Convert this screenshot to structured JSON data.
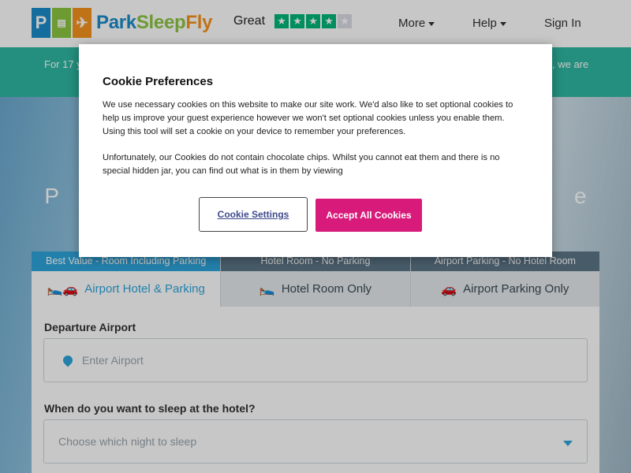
{
  "header": {
    "logo_text_1": "Park",
    "logo_text_2": "Sleep",
    "logo_text_3": "Fly",
    "trustpilot_label": "Great",
    "trustpilot_stars": 4,
    "nav": {
      "more": "More",
      "help": "Help",
      "sign_in": "Sign In"
    }
  },
  "banner": {
    "left_text": "For 17 y",
    "right_text": ", we are"
  },
  "hero": {
    "title_partial": "P                                                                                    e"
  },
  "tabs": [
    {
      "top": "Best Value - Room Including Parking",
      "label": "Airport Hotel & Parking",
      "icon": "bed-car-icon"
    },
    {
      "top": "Hotel Room - No Parking",
      "label": "Hotel Room Only",
      "icon": "bed-icon"
    },
    {
      "top": "Airport Parking - No Hotel Room",
      "label": "Airport Parking Only",
      "icon": "car-icon"
    }
  ],
  "form": {
    "departure_label": "Departure Airport",
    "departure_placeholder": "Enter Airport",
    "sleep_label": "When do you want to sleep at the hotel?",
    "sleep_placeholder": "Choose which night to sleep"
  },
  "cookie": {
    "title": "Cookie Preferences",
    "para1": "We use necessary cookies on this website to make our site work. We'd also like to set optional cookies to help us improve your guest experience however we won't set optional cookies unless you enable them. Using this tool will set a cookie on your device to remember your preferences.",
    "para2": "Unfortunately, our Cookies do not contain chocolate chips. Whilst you cannot eat them and there is no special hidden jar, you can find out what is in them by viewing",
    "settings_button": "Cookie Settings",
    "accept_button": "Accept All Cookies"
  },
  "colors": {
    "brand_blue": "#1b8cc9",
    "brand_green": "#8cc63f",
    "brand_orange": "#f7941d",
    "teal_banner": "#2fb8a2",
    "active_tab": "#2ea5dc",
    "accept_pink": "#d81b7a",
    "trustpilot_green": "#00b67a"
  }
}
